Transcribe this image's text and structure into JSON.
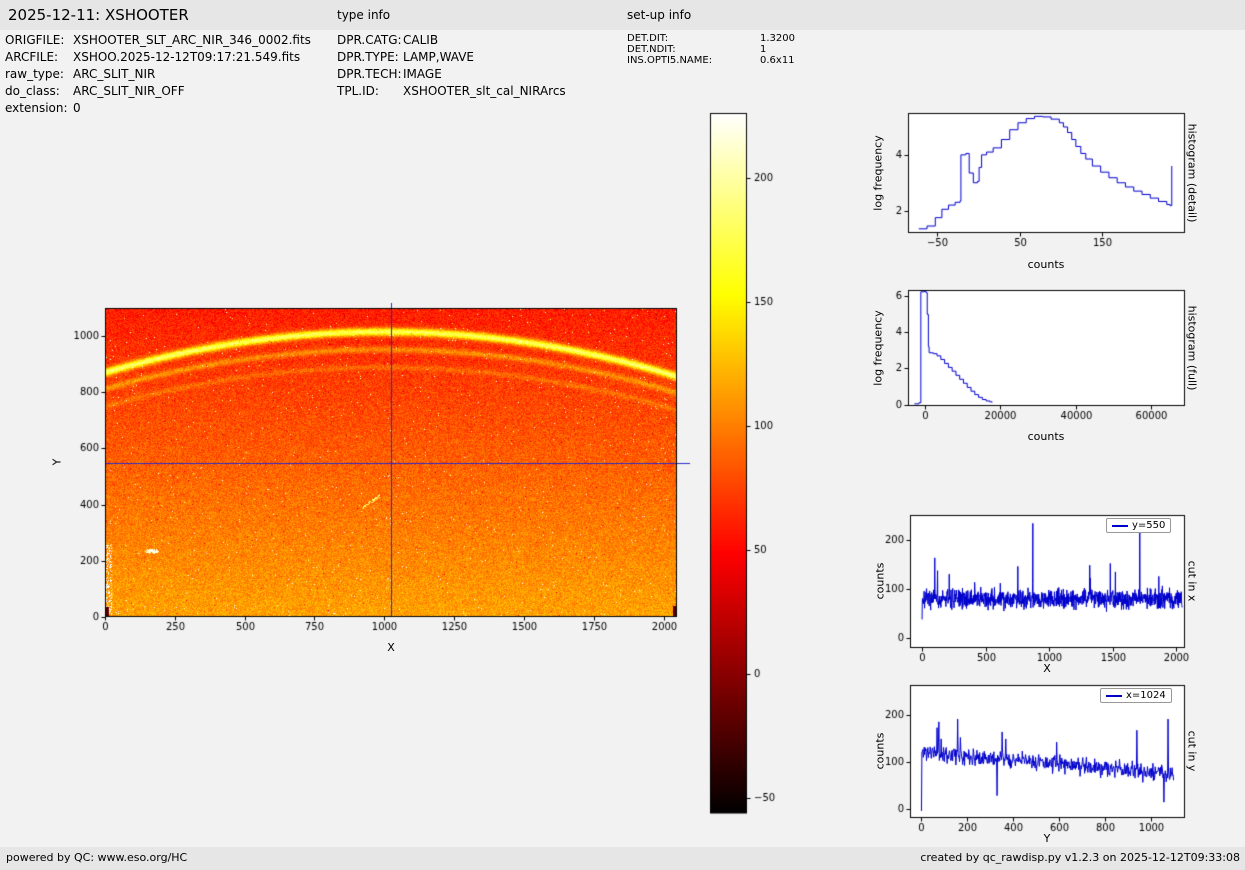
{
  "header": {
    "title": "2025-12-11: XSHOOTER",
    "type_info_label": "type info",
    "setup_info_label": "set-up info"
  },
  "file_info": [
    {
      "label": "ORIGFILE:",
      "value": "XSHOOTER_SLT_ARC_NIR_346_0002.fits"
    },
    {
      "label": "ARCFILE:",
      "value": "XSHOO.2025-12-12T09:17:21.549.fits"
    },
    {
      "label": "raw_type:",
      "value": "ARC_SLIT_NIR"
    },
    {
      "label": "do_class:",
      "value": "ARC_SLIT_NIR_OFF"
    },
    {
      "label": "extension:",
      "value": "0"
    }
  ],
  "type_info": [
    {
      "label": "DPR.CATG:",
      "value": "CALIB"
    },
    {
      "label": "DPR.TYPE:",
      "value": "LAMP,WAVE"
    },
    {
      "label": "DPR.TECH:",
      "value": "IMAGE"
    },
    {
      "label": "TPL.ID:",
      "value": "XSHOOTER_slt_cal_NIRArcs"
    }
  ],
  "setup_info": [
    {
      "label": "DET.DIT:",
      "value": "1.3200"
    },
    {
      "label": "DET.NDIT:",
      "value": "1"
    },
    {
      "label": "INS.OPTI5.NAME:",
      "value": "0.6x11"
    }
  ],
  "footer": {
    "left": "powered by QC: www.eso.org/HC",
    "right": "created by qc_rawdisp.py v1.2.3 on 2025-12-12T09:33:08"
  },
  "chart_data": [
    {
      "id": "detector-image",
      "type": "heatmap",
      "xlabel": "X",
      "ylabel": "Y",
      "xlim": [
        0,
        2048
      ],
      "ylim": [
        0,
        1100
      ],
      "xticks": [
        0,
        250,
        500,
        750,
        1000,
        1250,
        1500,
        1750,
        2000
      ],
      "yticks": [
        0,
        200,
        400,
        600,
        800,
        1000
      ],
      "colormap": "hot",
      "value_range": [
        -56,
        226
      ],
      "background": {
        "bottom_level": 115,
        "top_level": 60,
        "noise": 18
      },
      "arcs": [
        {
          "y_center": 1015,
          "sag": 145,
          "width": 14,
          "amplitude": 115
        },
        {
          "y_center": 952,
          "sag": 140,
          "width": 11,
          "amplitude": 38
        },
        {
          "y_center": 888,
          "sag": 138,
          "width": 10,
          "amplitude": 20
        }
      ],
      "crosshair": {
        "x": 1024,
        "y": 550,
        "color": "#2a2ac8"
      }
    },
    {
      "id": "colorbar",
      "type": "colorbar",
      "colormap": "hot",
      "range": [
        -56,
        226
      ],
      "ticks": [
        200,
        150,
        100,
        50,
        0,
        -50
      ]
    },
    {
      "id": "histogram-detail",
      "type": "line",
      "draw": "steps",
      "xlabel": "counts",
      "ylabel": "log frequency",
      "side_label": "histogram (detail)",
      "line_color": "#0000cd",
      "xlim": [
        -85,
        250
      ],
      "ylim": [
        1.2,
        5.5
      ],
      "xticks": [
        -50,
        50,
        150
      ],
      "yticks": [
        2,
        4
      ],
      "points": [
        [
          -72,
          1.35
        ],
        [
          -62,
          1.45
        ],
        [
          -52,
          1.75
        ],
        [
          -44,
          2.05
        ],
        [
          -36,
          2.2
        ],
        [
          -28,
          2.3
        ],
        [
          -22,
          2.35
        ],
        [
          -21,
          4.0
        ],
        [
          -15,
          4.05
        ],
        [
          -11,
          3.35
        ],
        [
          -6,
          3.0
        ],
        [
          -1,
          3.05
        ],
        [
          1,
          3.55
        ],
        [
          4,
          4.0
        ],
        [
          10,
          4.1
        ],
        [
          18,
          4.25
        ],
        [
          28,
          4.55
        ],
        [
          38,
          4.9
        ],
        [
          48,
          5.15
        ],
        [
          58,
          5.3
        ],
        [
          68,
          5.38
        ],
        [
          78,
          5.36
        ],
        [
          88,
          5.28
        ],
        [
          98,
          5.15
        ],
        [
          103,
          5.0
        ],
        [
          108,
          4.8
        ],
        [
          113,
          4.55
        ],
        [
          118,
          4.3
        ],
        [
          124,
          4.05
        ],
        [
          130,
          3.85
        ],
        [
          138,
          3.6
        ],
        [
          148,
          3.38
        ],
        [
          158,
          3.18
        ],
        [
          168,
          3.0
        ],
        [
          178,
          2.85
        ],
        [
          188,
          2.7
        ],
        [
          198,
          2.58
        ],
        [
          208,
          2.45
        ],
        [
          218,
          2.33
        ],
        [
          228,
          2.22
        ],
        [
          232,
          2.18
        ],
        [
          234,
          3.6
        ]
      ]
    },
    {
      "id": "histogram-full",
      "type": "line",
      "draw": "steps",
      "xlabel": "counts",
      "ylabel": "log frequency",
      "side_label": "histogram (full)",
      "line_color": "#0000cd",
      "xlim": [
        -4500,
        68900
      ],
      "ylim": [
        -0.08,
        6.35
      ],
      "xticks": [
        0,
        20000,
        40000,
        60000
      ],
      "yticks": [
        0,
        2,
        4,
        6
      ],
      "points": [
        [
          -2800,
          0.04
        ],
        [
          -1600,
          0.1
        ],
        [
          -1100,
          6.25
        ],
        [
          -200,
          6.27
        ],
        [
          300,
          6.2
        ],
        [
          600,
          5.0
        ],
        [
          900,
          3.2
        ],
        [
          1100,
          2.87
        ],
        [
          2200,
          2.82
        ],
        [
          3200,
          2.7
        ],
        [
          4200,
          2.5
        ],
        [
          5200,
          2.28
        ],
        [
          6200,
          2.06
        ],
        [
          7200,
          1.85
        ],
        [
          8200,
          1.62
        ],
        [
          9200,
          1.4
        ],
        [
          10200,
          1.18
        ],
        [
          11200,
          0.95
        ],
        [
          12200,
          0.74
        ],
        [
          13200,
          0.55
        ],
        [
          14200,
          0.4
        ],
        [
          15200,
          0.28
        ],
        [
          16200,
          0.2
        ],
        [
          17200,
          0.15
        ],
        [
          17800,
          0.12
        ]
      ]
    },
    {
      "id": "cut-in-x",
      "type": "line",
      "xlabel": "X",
      "ylabel": "counts",
      "side_label": "cut in x",
      "legend": "y=550",
      "line_color": "#0000cd",
      "xlim": [
        -95,
        2070
      ],
      "ylim": [
        -20,
        250
      ],
      "xticks": [
        0,
        500,
        1000,
        1500,
        2000
      ],
      "yticks": [
        0,
        100,
        200
      ],
      "signal": {
        "n": 2048,
        "step": 2,
        "base": 80,
        "noise": 20,
        "seed": 7,
        "spikes": [
          [
            0,
            38
          ],
          [
            100,
            163
          ],
          [
            872,
            233
          ],
          [
            1320,
            148
          ],
          [
            1714,
            238
          ]
        ]
      }
    },
    {
      "id": "cut-in-y",
      "type": "line",
      "xlabel": "Y",
      "ylabel": "counts",
      "side_label": "cut in y",
      "legend": "x=1024",
      "line_color": "#0000cd",
      "xlim": [
        -50,
        1150
      ],
      "ylim": [
        -20,
        265
      ],
      "xticks": [
        0,
        200,
        400,
        600,
        800,
        1000
      ],
      "yticks": [
        0,
        100,
        200
      ],
      "signal": {
        "n": 1100,
        "step": 2,
        "base_start": 122,
        "base_end": 74,
        "noise": 18,
        "seed": 11,
        "spikes": [
          [
            0,
            -5
          ],
          [
            76,
            186
          ],
          [
            158,
            192
          ],
          [
            330,
            28
          ],
          [
            940,
            168
          ],
          [
            1058,
            14
          ],
          [
            1076,
            192
          ]
        ]
      }
    }
  ]
}
